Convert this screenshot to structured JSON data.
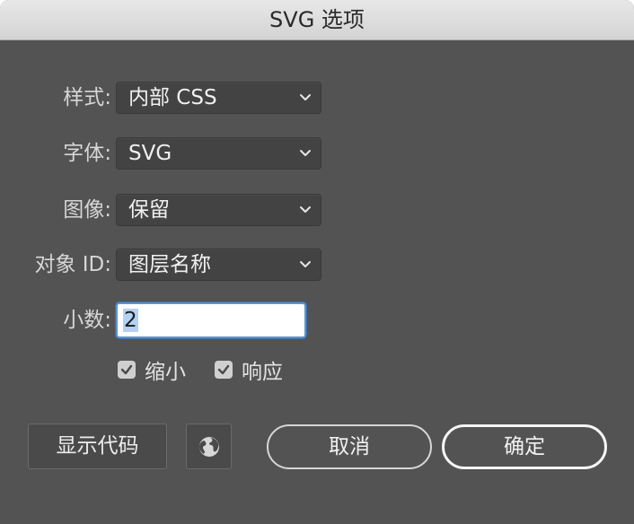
{
  "dialog": {
    "title": "SVG 选项"
  },
  "fields": {
    "style": {
      "label": "样式:",
      "value": "内部 CSS"
    },
    "font": {
      "label": "字体:",
      "value": "SVG"
    },
    "image": {
      "label": "图像:",
      "value": "保留"
    },
    "object_id": {
      "label": "对象 ID:",
      "value": "图层名称"
    },
    "decimal": {
      "label": "小数:",
      "value": "2"
    }
  },
  "checkboxes": {
    "minify": {
      "label": "缩小",
      "checked": true
    },
    "responsive": {
      "label": "响应",
      "checked": true
    }
  },
  "buttons": {
    "show_code": "显示代码",
    "globe_icon": "globe-icon",
    "cancel": "取消",
    "ok": "确定"
  },
  "colors": {
    "dialog_bg": "#535353",
    "focus_ring": "#5a94d4",
    "text_selection": "#b3d1f3"
  }
}
